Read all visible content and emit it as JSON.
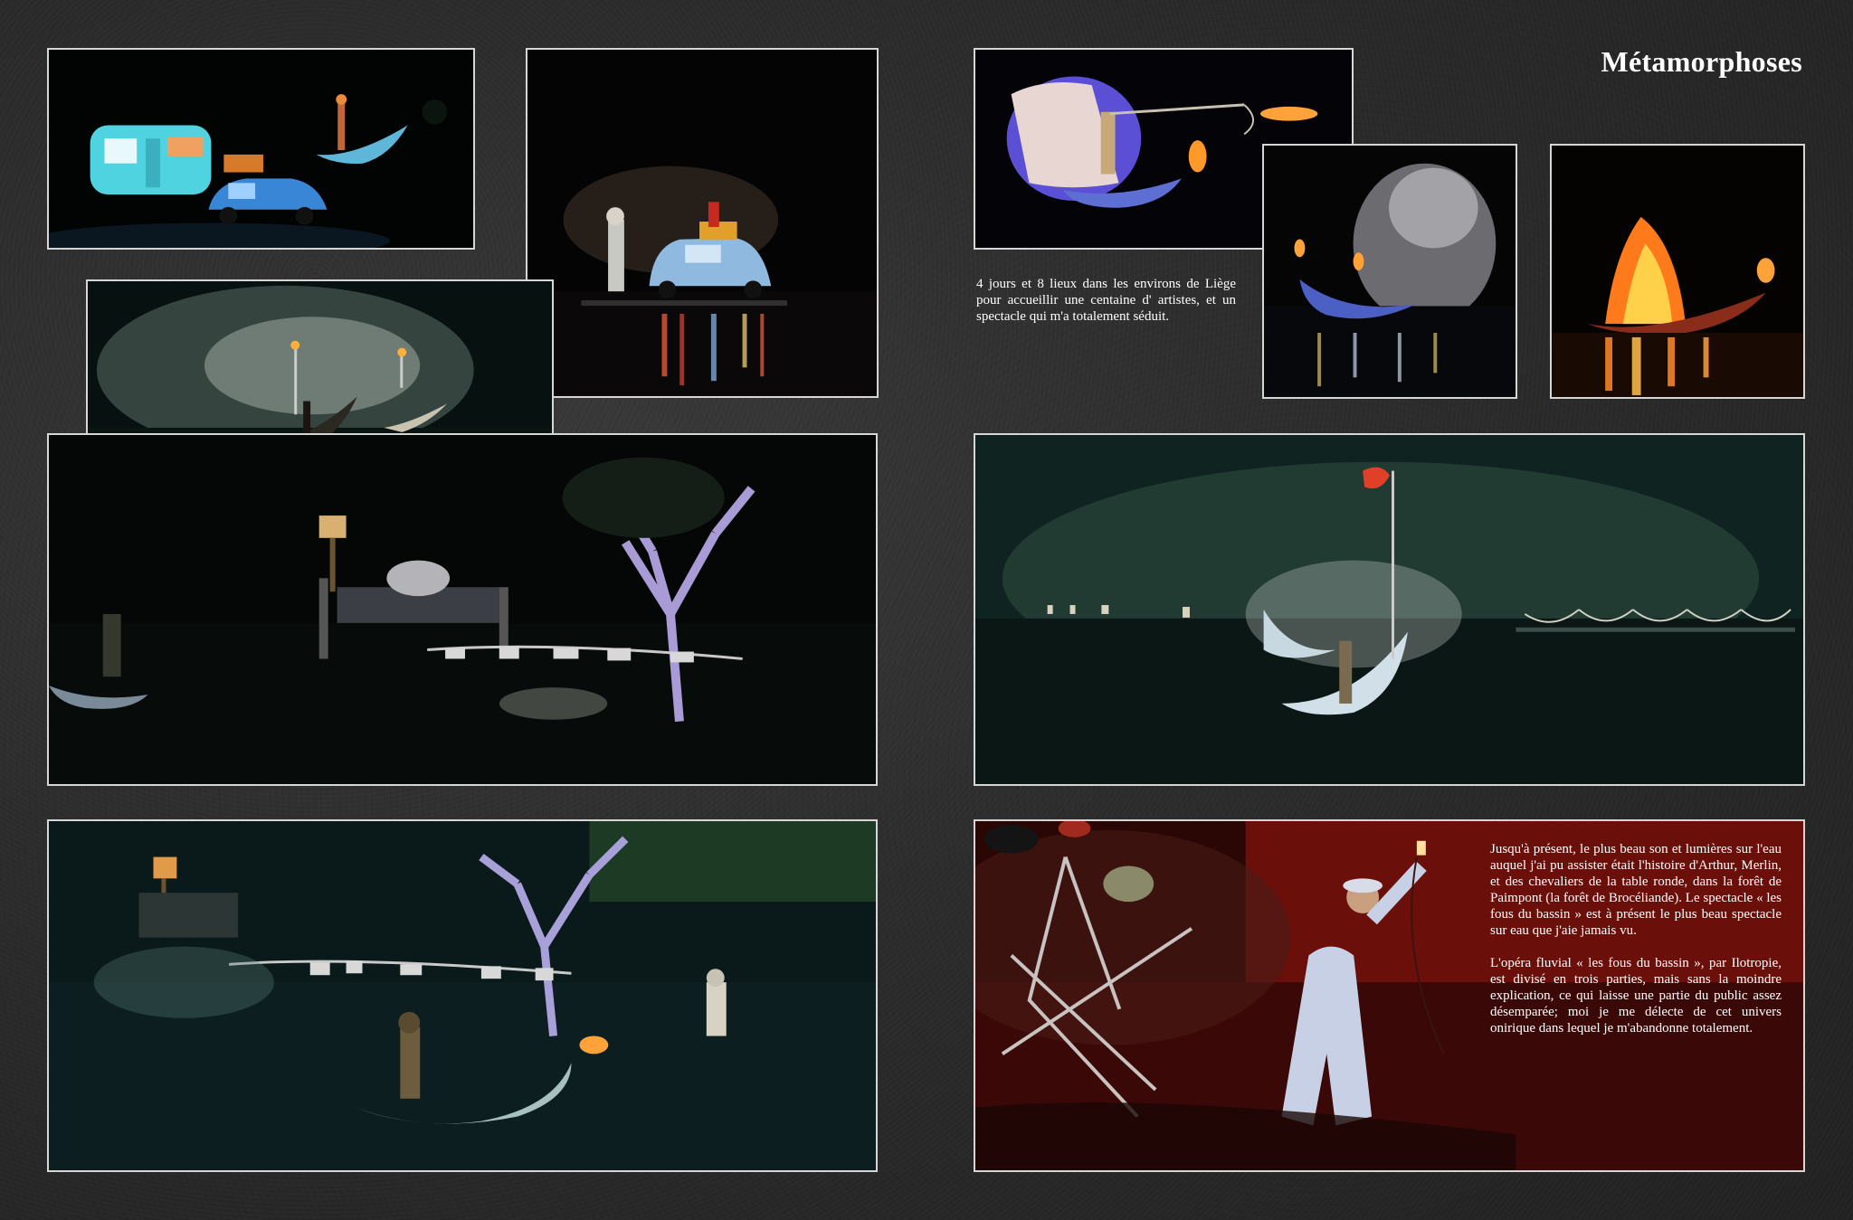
{
  "page": {
    "title": "Métamorphoses",
    "intro_text": "4 jours et 8 lieux dans les environs de Liège pour accueillir une centaine d' artistes, et un spectacle qui m'a totalement séduit.",
    "story_paragraphs": [
      "Jusqu'à présent, le plus beau son et lumières sur l'eau auquel j'ai pu assister était l'histoire d'Arthur, Merlin, et des chevaliers de la table ronde, dans la forêt de Paimpont (la forêt de Brocéliande). Le spectacle « les fous du bassin » est à présent le plus beau spectacle sur eau que j'aie jamais vu.",
      "L'opéra fluvial « les fous du bassin », par Ilotropie, est divisé en trois parties, mais sans la moindre explication, ce qui laisse une partie du public assez désemparée; moi je me délecte de cet univers onirique dans lequel je m'abandonne totalement."
    ]
  },
  "photos": [
    {
      "name": "caravan-car-photo",
      "description": "turquoise caravan and blue car by night, figure in boat"
    },
    {
      "name": "car-on-water-photo",
      "description": "blue car on water with performers"
    },
    {
      "name": "sparks-boat-photo",
      "description": "boat with torch in shower of sparks"
    },
    {
      "name": "bed-tree-photo",
      "description": "floating bed with lamp and lit tree"
    },
    {
      "name": "gondola-wings-photo",
      "description": "performer with white wings in boat, flaming hook"
    },
    {
      "name": "boat-smoke-photo",
      "description": "boat with torches and white smoke"
    },
    {
      "name": "fire-boat-photo",
      "description": "boat engulfed in flames"
    },
    {
      "name": "green-boats-photo",
      "description": "two white boats in green mist"
    },
    {
      "name": "green-scene-photo",
      "description": "performer on boat with fire, bed and tree in green light"
    },
    {
      "name": "red-scene-photo",
      "description": "performer in white suit holding lamp, red light"
    }
  ],
  "colors": {
    "background": "#2c2c2c",
    "border": "#d6d6d6",
    "text": "#ffffff"
  }
}
